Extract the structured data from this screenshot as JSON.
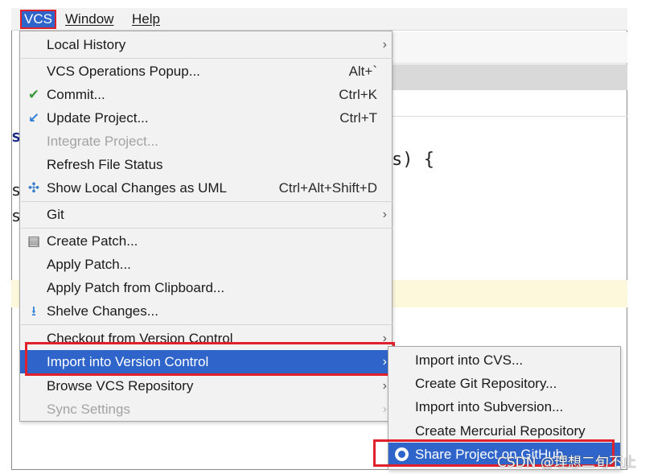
{
  "menubar": {
    "items": [
      {
        "label": "VCS"
      },
      {
        "label": "Window"
      },
      {
        "label": "Help"
      }
    ]
  },
  "editor": {
    "code_fragment": "s) {",
    "gutter_chars": [
      "s",
      "s",
      "s"
    ]
  },
  "vcs_menu": {
    "items": [
      {
        "label": "Local History",
        "shortcut": "",
        "submenu": true
      },
      {
        "label": "VCS Operations Popup...",
        "shortcut": "Alt+`"
      },
      {
        "label": "Commit...",
        "shortcut": "Ctrl+K",
        "icon": "commit-check-icon"
      },
      {
        "label": "Update Project...",
        "shortcut": "Ctrl+T",
        "icon": "update-arrow-icon"
      },
      {
        "label": "Integrate Project...",
        "shortcut": "",
        "disabled": true
      },
      {
        "label": "Refresh File Status",
        "shortcut": ""
      },
      {
        "label": "Show Local Changes as UML",
        "shortcut": "Ctrl+Alt+Shift+D",
        "icon": "uml-diagram-icon"
      },
      {
        "label": "Git",
        "shortcut": "",
        "submenu": true
      },
      {
        "label": "Create Patch...",
        "shortcut": "",
        "icon": "patch-icon"
      },
      {
        "label": "Apply Patch...",
        "shortcut": ""
      },
      {
        "label": "Apply Patch from Clipboard...",
        "shortcut": ""
      },
      {
        "label": "Shelve Changes...",
        "shortcut": "",
        "icon": "shelve-icon"
      },
      {
        "label": "Checkout from Version Control",
        "shortcut": "",
        "submenu": true
      },
      {
        "label": "Import into Version Control",
        "shortcut": "",
        "submenu": true,
        "selected": true
      },
      {
        "label": "Browse VCS Repository",
        "shortcut": "",
        "submenu": true
      },
      {
        "label": "Sync Settings",
        "shortcut": "",
        "submenu": true,
        "disabled": true
      }
    ]
  },
  "import_submenu": {
    "items": [
      {
        "label": "Import into CVS..."
      },
      {
        "label": "Create Git Repository..."
      },
      {
        "label": "Import into Subversion..."
      },
      {
        "label": "Create Mercurial Repository"
      },
      {
        "label": "Share Project on GitHub",
        "selected": true,
        "icon": "github-icon"
      }
    ]
  },
  "watermark": "CSDN @理想二旬不止",
  "colors": {
    "selection": "#2f65ca",
    "highlight_box": "#e0202a",
    "menu_bg": "#f2f2f2",
    "disabled_text": "#a3a3a3"
  }
}
